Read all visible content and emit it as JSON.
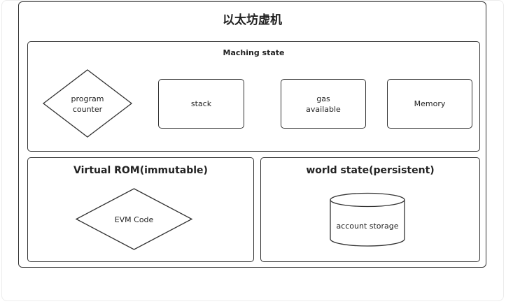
{
  "title": "以太坊虚机",
  "machine_state": {
    "title": "Maching state",
    "program_counter": [
      "program",
      "counter"
    ],
    "stack": "stack",
    "gas": [
      "gas",
      "available"
    ],
    "memory": "Memory"
  },
  "virtual_rom": {
    "title": "Virtual ROM(immutable)",
    "evm_code": "EVM  Code"
  },
  "world_state": {
    "title": "world state(persistent)",
    "storage": "account storage"
  }
}
